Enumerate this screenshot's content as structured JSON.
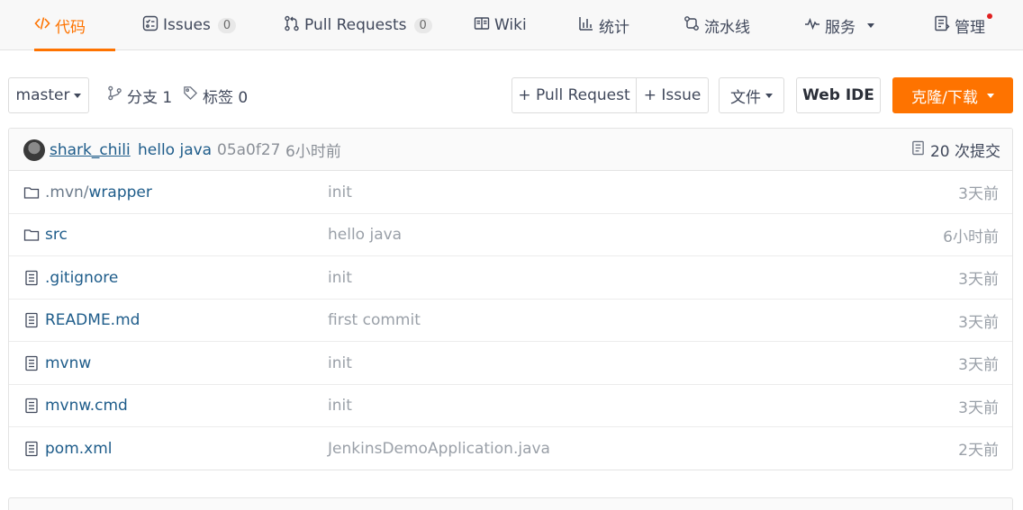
{
  "tabs": [
    {
      "label": "代码",
      "icon": "code-icon",
      "active": true
    },
    {
      "label": "Issues",
      "icon": "issues-icon",
      "count": "0"
    },
    {
      "label": "Pull Requests",
      "icon": "pull-request-icon",
      "count": "0"
    },
    {
      "label": "Wiki",
      "icon": "book-icon"
    },
    {
      "label": "统计",
      "icon": "bar-chart-icon"
    },
    {
      "label": "流水线",
      "icon": "pipeline-icon"
    },
    {
      "label": "服务",
      "icon": "pulse-icon"
    },
    {
      "label": "管理",
      "icon": "manage-icon"
    }
  ],
  "toolbar": {
    "branch": "master",
    "branches_label": "分支 1",
    "tags_label": "标签 0",
    "pull_request_btn": "+ Pull Request",
    "issue_btn": "+ Issue",
    "file_btn": "文件",
    "webide_btn": "Web IDE",
    "clone_btn": "克隆/下载"
  },
  "commit": {
    "author": "shark_chili",
    "message": "hello java",
    "hash": "05a0f27",
    "time": "6小时前",
    "commits_label": "20 次提交"
  },
  "files": [
    {
      "type": "folder",
      "name_prefix": ".mvn/",
      "name": "wrapper",
      "message": "init",
      "time": "3天前"
    },
    {
      "type": "folder",
      "name_prefix": "",
      "name": "src",
      "message": "hello java",
      "time": "6小时前"
    },
    {
      "type": "file",
      "name_prefix": "",
      "name": ".gitignore",
      "message": "init",
      "time": "3天前"
    },
    {
      "type": "file",
      "name_prefix": "",
      "name": "README.md",
      "message": "first commit",
      "time": "3天前"
    },
    {
      "type": "file",
      "name_prefix": "",
      "name": "mvnw",
      "message": "init",
      "time": "3天前"
    },
    {
      "type": "file",
      "name_prefix": "",
      "name": "mvnw.cmd",
      "message": "init",
      "time": "3天前"
    },
    {
      "type": "file",
      "name_prefix": "",
      "name": "pom.xml",
      "message": "JenkinsDemoApplication.java",
      "time": "2天前"
    }
  ],
  "colors": {
    "accent": "#fe7300",
    "link": "#1e5c8a",
    "muted": "#9aa0a8"
  }
}
